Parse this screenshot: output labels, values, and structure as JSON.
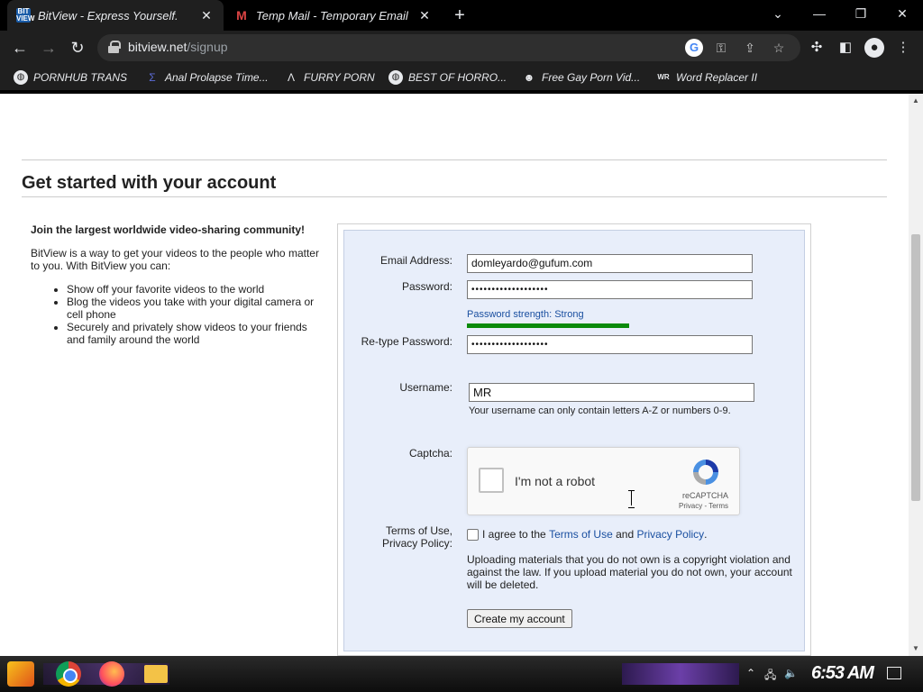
{
  "browser": {
    "tabs": [
      {
        "title": "BitView - Express Yourself.",
        "favicon": "BIT VIEW",
        "active": true
      },
      {
        "title": "Temp Mail - Temporary Email",
        "favicon": "gmail-m-icon",
        "active": false
      }
    ],
    "new_tab_symbol": "+",
    "url_host": "bitview.net",
    "url_path": "/signup",
    "bookmarks": [
      {
        "label": "PORNHUB TRANS",
        "icon": "globe-icon"
      },
      {
        "label": "Anal Prolapse Time...",
        "icon": "sigma-icon"
      },
      {
        "label": "FURRY PORN",
        "icon": "lambda-icon"
      },
      {
        "label": "BEST OF HORRO...",
        "icon": "globe-icon"
      },
      {
        "label": "Free Gay Porn Vid...",
        "icon": "mask-icon"
      },
      {
        "label": "Word Replacer II",
        "icon": "wr-icon"
      }
    ]
  },
  "page": {
    "title": "Get started with your account",
    "intro": {
      "heading": "Join the largest worldwide video-sharing community!",
      "description": "BitView is a way to get your videos to the people who matter to you. With BitView you can:",
      "bullets": [
        "Show off your favorite videos to the world",
        "Blog the videos you take with your digital camera or cell phone",
        "Securely and privately show videos to your friends and family around the world"
      ]
    },
    "form": {
      "email_label": "Email Address:",
      "email_value": "domleyardo@gufum.com",
      "password_label": "Password:",
      "password_value": "•••••••••••••••••••",
      "strength_text": "Password strength: Strong",
      "strength_level": 1.0,
      "retype_label": "Re-type Password:",
      "retype_value": "•••••••••••••••••••",
      "username_label": "Username:",
      "username_value": "MR",
      "username_hint": "Your username can only contain letters A-Z or numbers 0-9.",
      "captcha_label": "Captcha:",
      "captcha_text": "I'm not a robot",
      "captcha_brand": "reCAPTCHA",
      "captcha_links": "Privacy - Terms",
      "terms_label_1": "Terms of Use,",
      "terms_label_2": "Privacy Policy:",
      "agree_prefix": "I agree to the",
      "terms_link": "Terms of Use",
      "agree_and": "and",
      "privacy_link": "Privacy Policy",
      "agree_suffix": ".",
      "warning": "Uploading materials that you do not own is a copyright violation and against the law. If you upload material you do not own, your account will be deleted.",
      "submit_label": "Create my account"
    }
  },
  "taskbar": {
    "clock": "6:53 AM"
  },
  "colors": {
    "form_bg": "#e8eefa",
    "link": "#1a4fa0",
    "strength_bar": "#0a8a0a"
  }
}
